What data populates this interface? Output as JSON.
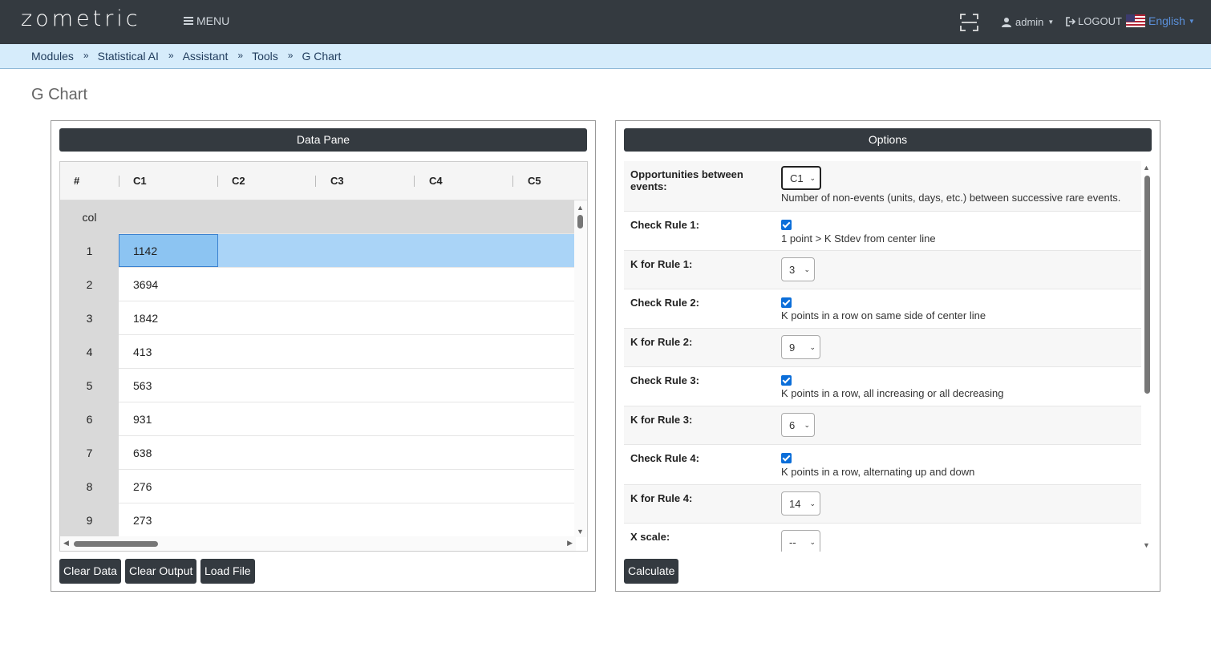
{
  "navbar": {
    "logo": "zometric",
    "menu_label": "MENU",
    "user_label": "admin",
    "logout_label": "LOGOUT",
    "language_label": "English"
  },
  "breadcrumb": [
    "Modules",
    "Statistical AI",
    "Assistant",
    "Tools",
    "G Chart"
  ],
  "breadcrumb_separator": "»",
  "page_title": "G Chart",
  "data_pane": {
    "title": "Data Pane",
    "columns": [
      "#",
      "C1",
      "C2",
      "C3",
      "C4",
      "C5"
    ],
    "name_row_label": "col",
    "rows": [
      {
        "index": "1",
        "c1": "1142"
      },
      {
        "index": "2",
        "c1": "3694"
      },
      {
        "index": "3",
        "c1": "1842"
      },
      {
        "index": "4",
        "c1": "413"
      },
      {
        "index": "5",
        "c1": "563"
      },
      {
        "index": "6",
        "c1": "931"
      },
      {
        "index": "7",
        "c1": "638"
      },
      {
        "index": "8",
        "c1": "276"
      },
      {
        "index": "9",
        "c1": "273"
      }
    ],
    "buttons": {
      "clear_data": "Clear Data",
      "clear_output": "Clear Output",
      "load_file": "Load File"
    }
  },
  "options": {
    "title": "Options",
    "opportunities": {
      "label": "Opportunities between events:",
      "value": "C1",
      "description": "Number of non-events (units, days, etc.) between successive rare events."
    },
    "rule1": {
      "label": "Check Rule 1:",
      "checked": true,
      "description": "1 point > K Stdev from center line"
    },
    "k1": {
      "label": "K for Rule 1:",
      "value": "3"
    },
    "rule2": {
      "label": "Check Rule 2:",
      "checked": true,
      "description": "K points in a row on same side of center line"
    },
    "k2": {
      "label": "K for Rule 2:",
      "value": "9"
    },
    "rule3": {
      "label": "Check Rule 3:",
      "checked": true,
      "description": "K points in a row, all increasing or all decreasing"
    },
    "k3": {
      "label": "K for Rule 3:",
      "value": "6"
    },
    "rule4": {
      "label": "Check Rule 4:",
      "checked": true,
      "description": "K points in a row, alternating up and down"
    },
    "k4": {
      "label": "K for Rule 4:",
      "value": "14"
    },
    "xscale": {
      "label": "X scale:",
      "value": "--"
    },
    "calculate_label": "Calculate"
  }
}
